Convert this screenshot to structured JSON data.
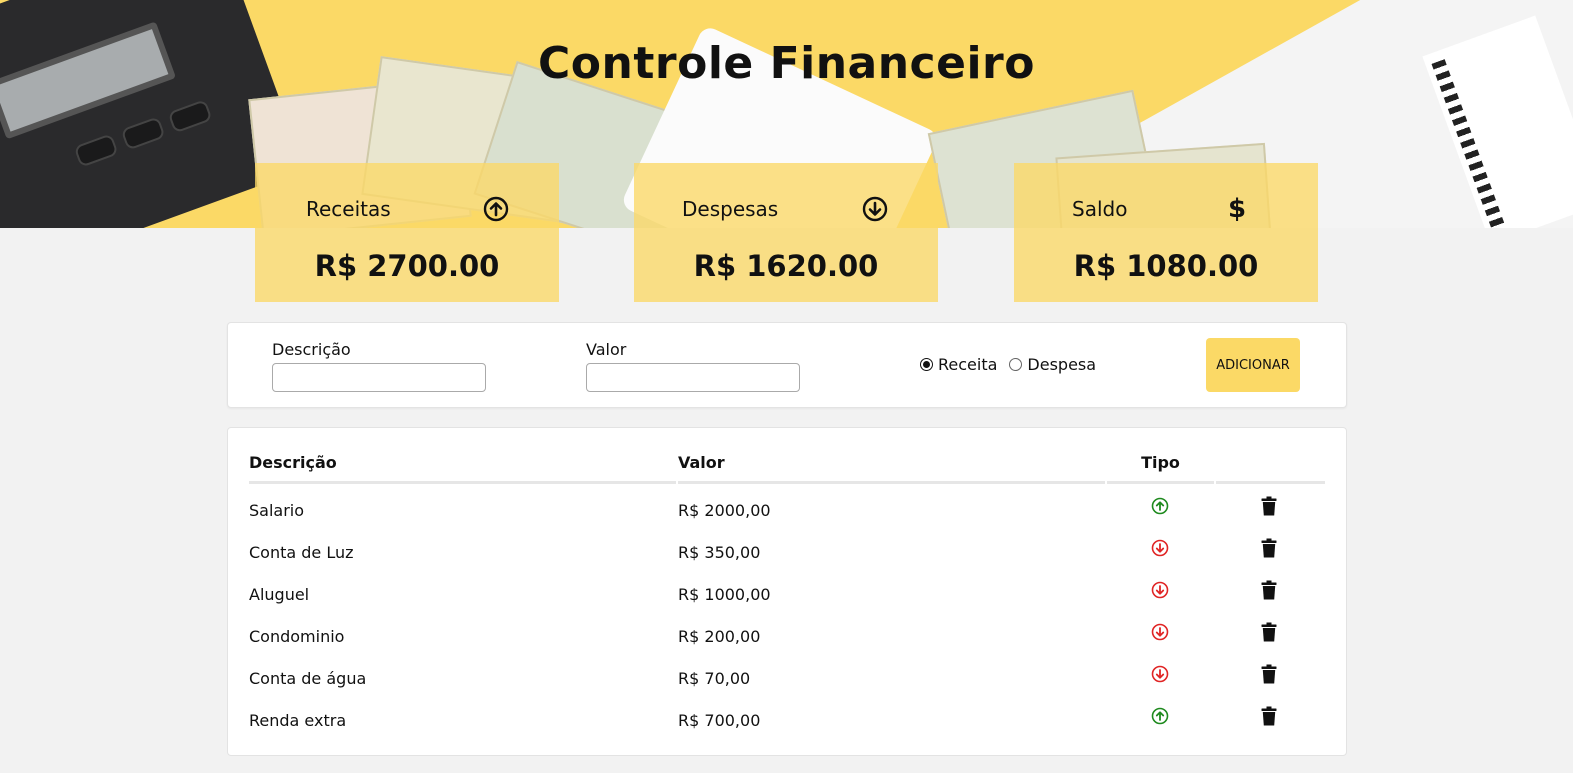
{
  "header": {
    "title": "Controle Financeiro"
  },
  "summary": {
    "income": {
      "label": "Receitas",
      "amount": "R$ 2700.00",
      "icon": "arrow-up-circle-icon"
    },
    "expense": {
      "label": "Despesas",
      "amount": "R$ 1620.00",
      "icon": "arrow-down-circle-icon"
    },
    "balance": {
      "label": "Saldo",
      "amount": "R$ 1080.00",
      "icon": "dollar-icon",
      "icon_glyph": "$"
    }
  },
  "form": {
    "description_label": "Descrição",
    "description_value": "",
    "value_label": "Valor",
    "value_value": "",
    "type_options": [
      "Receita",
      "Despesa"
    ],
    "selected_type": "Receita",
    "add_button": "ADICIONAR"
  },
  "table": {
    "columns": [
      "Descrição",
      "Valor",
      "Tipo",
      ""
    ],
    "rows": [
      {
        "description": "Salario",
        "value": "R$ 2000,00",
        "type": "income"
      },
      {
        "description": "Conta de Luz",
        "value": "R$ 350,00",
        "type": "expense"
      },
      {
        "description": "Aluguel",
        "value": "R$ 1000,00",
        "type": "expense"
      },
      {
        "description": "Condominio",
        "value": "R$ 200,00",
        "type": "expense"
      },
      {
        "description": "Conta de água",
        "value": "R$ 70,00",
        "type": "expense"
      },
      {
        "description": "Renda extra",
        "value": "R$ 700,00",
        "type": "income"
      }
    ]
  },
  "colors": {
    "accent": "#fbd966",
    "income": "#1e8a1e",
    "expense": "#e02424",
    "background": "#f2f2f2"
  }
}
